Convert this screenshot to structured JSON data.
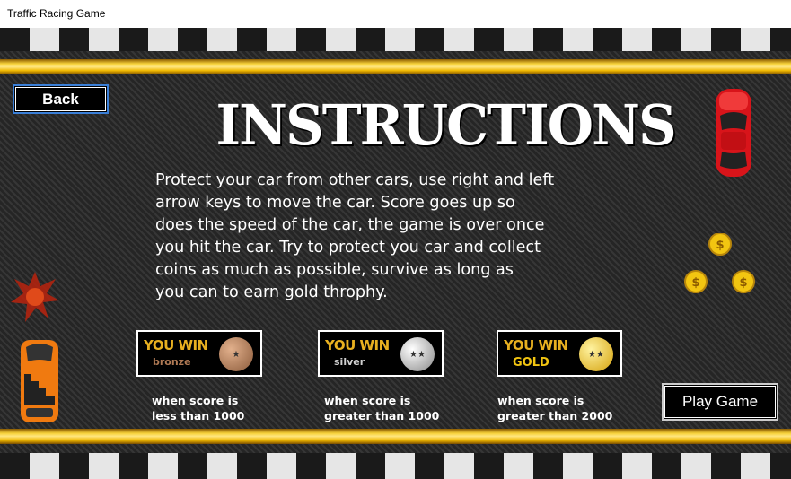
{
  "window": {
    "title": "Traffic Racing Game"
  },
  "buttons": {
    "back": "Back",
    "play": "Play Game"
  },
  "heading": "INSTRUCTIONS",
  "instructions": [
    "Protect your car from other cars, use right and left",
    "arrow keys to move the car. Score goes up so",
    "does the speed of the car, the game is over once",
    "you hit the car. Try to protect you car and collect",
    "coins as much as possible, survive as long as",
    "you can  to earn gold throphy."
  ],
  "trophies": [
    {
      "you_win": "YOU WIN",
      "tier": "bronze",
      "caption1": "when score is",
      "caption2": "less than 1000",
      "color": "#b07a55"
    },
    {
      "you_win": "YOU WIN",
      "tier": "silver",
      "caption1": "when score is",
      "caption2": "greater than 1000",
      "color": "#c8c8c8"
    },
    {
      "you_win": "YOU WIN",
      "tier": "GOLD",
      "caption1": "when score is",
      "caption2": "greater than 2000",
      "color": "#f2c511"
    }
  ],
  "coin_symbol": "$",
  "icons": [
    "red-car-icon",
    "orange-car-icon",
    "coin-icon",
    "explosion-icon"
  ]
}
